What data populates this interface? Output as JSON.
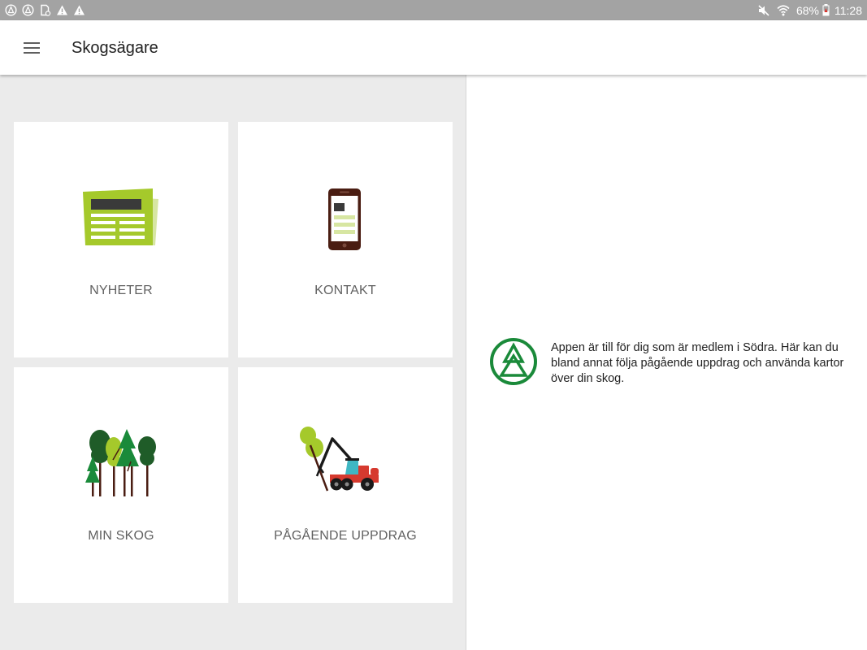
{
  "status_bar": {
    "left_icons": [
      "notification-icon",
      "notification-icon",
      "document-icon",
      "warning-icon",
      "warning-icon"
    ],
    "right_icons": [
      "mute-icon",
      "wifi-icon"
    ],
    "battery_percent": "68%",
    "time": "11:28"
  },
  "app_bar": {
    "menu_icon": "hamburger-menu-icon",
    "title": "Skogsägare"
  },
  "tiles": [
    {
      "label": "NYHETER",
      "icon": "newspaper-icon"
    },
    {
      "label": "KONTAKT",
      "icon": "phone-icon"
    },
    {
      "label": "MIN SKOG",
      "icon": "forest-icon"
    },
    {
      "label": "PÅGÅENDE UPPDRAG",
      "icon": "forest-harvester-icon"
    }
  ],
  "info": {
    "logo_icon": "sodra-logo-icon",
    "text": "Appen är till för dig som är medlem i Södra. Här kan du bland annat följa pågående uppdrag och använda kartor över din skog."
  },
  "colors": {
    "status_bar": "#a3a3a3",
    "panel_background": "#ebebeb",
    "accent_green": "#a5c92b",
    "brand_green": "#1a8a3a",
    "harvester_red": "#d63a2f"
  }
}
